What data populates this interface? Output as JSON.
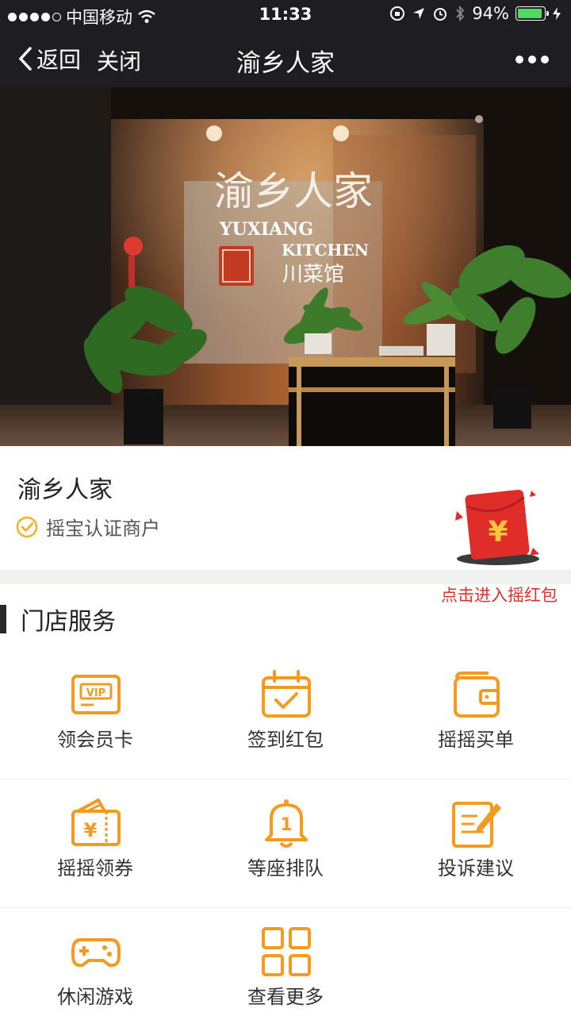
{
  "status_bar": {
    "carrier": "中国移动",
    "time": "11:33",
    "battery": "94%",
    "battery_level": 0.94
  },
  "nav": {
    "back_label": "返回",
    "close_label": "关闭",
    "title": "渝乡人家"
  },
  "hero": {
    "sign_main": "渝乡人家",
    "sign_en_1": "YUXIANG",
    "sign_en_2": "KITCHEN",
    "sign_sub": "川菜馆"
  },
  "merchant": {
    "name": "渝乡人家",
    "certification": "摇宝认证商户",
    "red_packet_label": "点击进入摇红包"
  },
  "services": {
    "title": "门店服务",
    "items": [
      {
        "label": "领会员卡",
        "icon": "vip-card-icon"
      },
      {
        "label": "签到红包",
        "icon": "calendar-check-icon"
      },
      {
        "label": "摇摇买单",
        "icon": "wallet-icon"
      },
      {
        "label": "摇摇领券",
        "icon": "coupon-icon"
      },
      {
        "label": "等座排队",
        "icon": "bell-queue-icon"
      },
      {
        "label": "投诉建议",
        "icon": "edit-feedback-icon"
      },
      {
        "label": "休闲游戏",
        "icon": "gamepad-icon"
      },
      {
        "label": "查看更多",
        "icon": "grid-more-icon"
      }
    ]
  },
  "colors": {
    "accent": "#f39a1f",
    "red": "#e0302d",
    "bar": "#1e1e22"
  }
}
